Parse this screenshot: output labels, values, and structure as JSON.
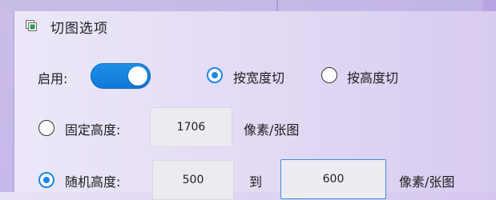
{
  "panel": {
    "title": "切图选项"
  },
  "enable": {
    "label": "启用:",
    "on": true
  },
  "mode": {
    "by_width": "按宽度切",
    "by_height": "按高度切",
    "selected": "by_width"
  },
  "fixed_height": {
    "label": "固定高度:",
    "value": "1706",
    "unit": "像素/张图",
    "selected": false
  },
  "random_height": {
    "label": "随机高度:",
    "min": "500",
    "to_label": "到",
    "max": "600",
    "unit": "像素/张图",
    "selected": true
  },
  "colors": {
    "accent": "#1b87e4"
  }
}
